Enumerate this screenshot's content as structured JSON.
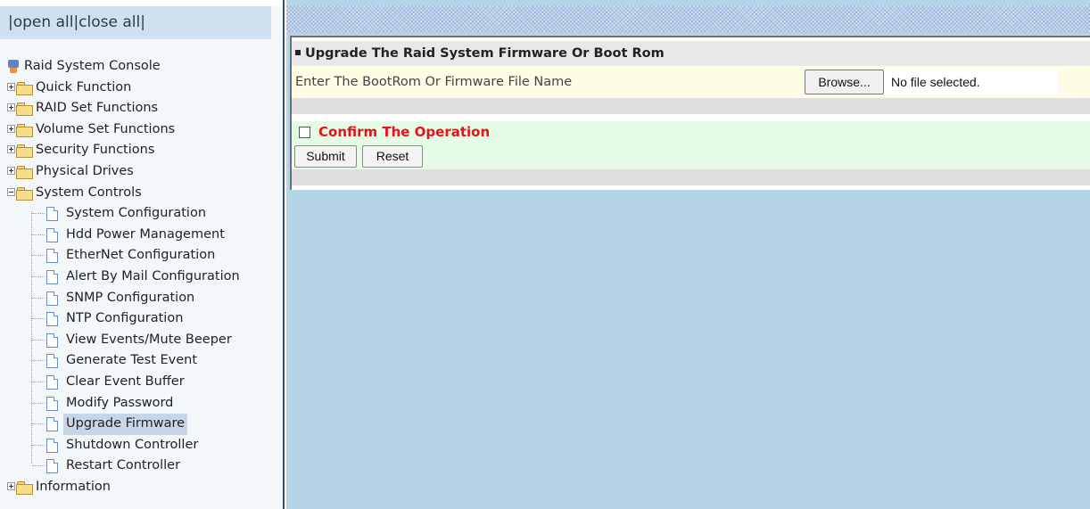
{
  "nav": {
    "open_all": "open all",
    "close_all": "close all",
    "sep_left": "|",
    "sep_mid": "|",
    "sep_right": "|"
  },
  "tree": {
    "root": "Raid System Console",
    "quick_function": "Quick Function",
    "raid_set_functions": "RAID Set Functions",
    "volume_set_functions": "Volume Set Functions",
    "security_functions": "Security Functions",
    "physical_drives": "Physical Drives",
    "system_controls": "System Controls",
    "children": [
      "System Configuration",
      "Hdd Power Management",
      "EtherNet Configuration",
      "Alert By Mail Configuration",
      "SNMP Configuration",
      "NTP Configuration",
      "View Events/Mute Beeper",
      "Generate Test Event",
      "Clear Event Buffer",
      "Modify Password",
      "Upgrade Firmware",
      "Shutdown Controller",
      "Restart Controller"
    ],
    "selected": "Upgrade Firmware",
    "information": "Information"
  },
  "main": {
    "title": "Upgrade The Raid System Firmware Or Boot Rom",
    "file_prompt": "Enter The BootRom Or Firmware File Name",
    "browse_label": "Browse...",
    "file_status": "No file selected.",
    "confirm_label": "Confirm The Operation",
    "confirm_checked": false,
    "submit_label": "Submit",
    "reset_label": "Reset"
  },
  "colors": {
    "left_bg": "#f3f7fa",
    "header_bg": "#cfe1f1",
    "right_bg": "#b3d5e7",
    "confirm_color": "#e8121a",
    "file_row_bg": "#fffce6",
    "confirm_row_bg": "#e6fbe6"
  },
  "icons": {
    "root": "server-icon",
    "folder": "folder-icon",
    "page": "page-icon",
    "expand": "plus-box-icon",
    "collapse": "minus-box-icon"
  }
}
